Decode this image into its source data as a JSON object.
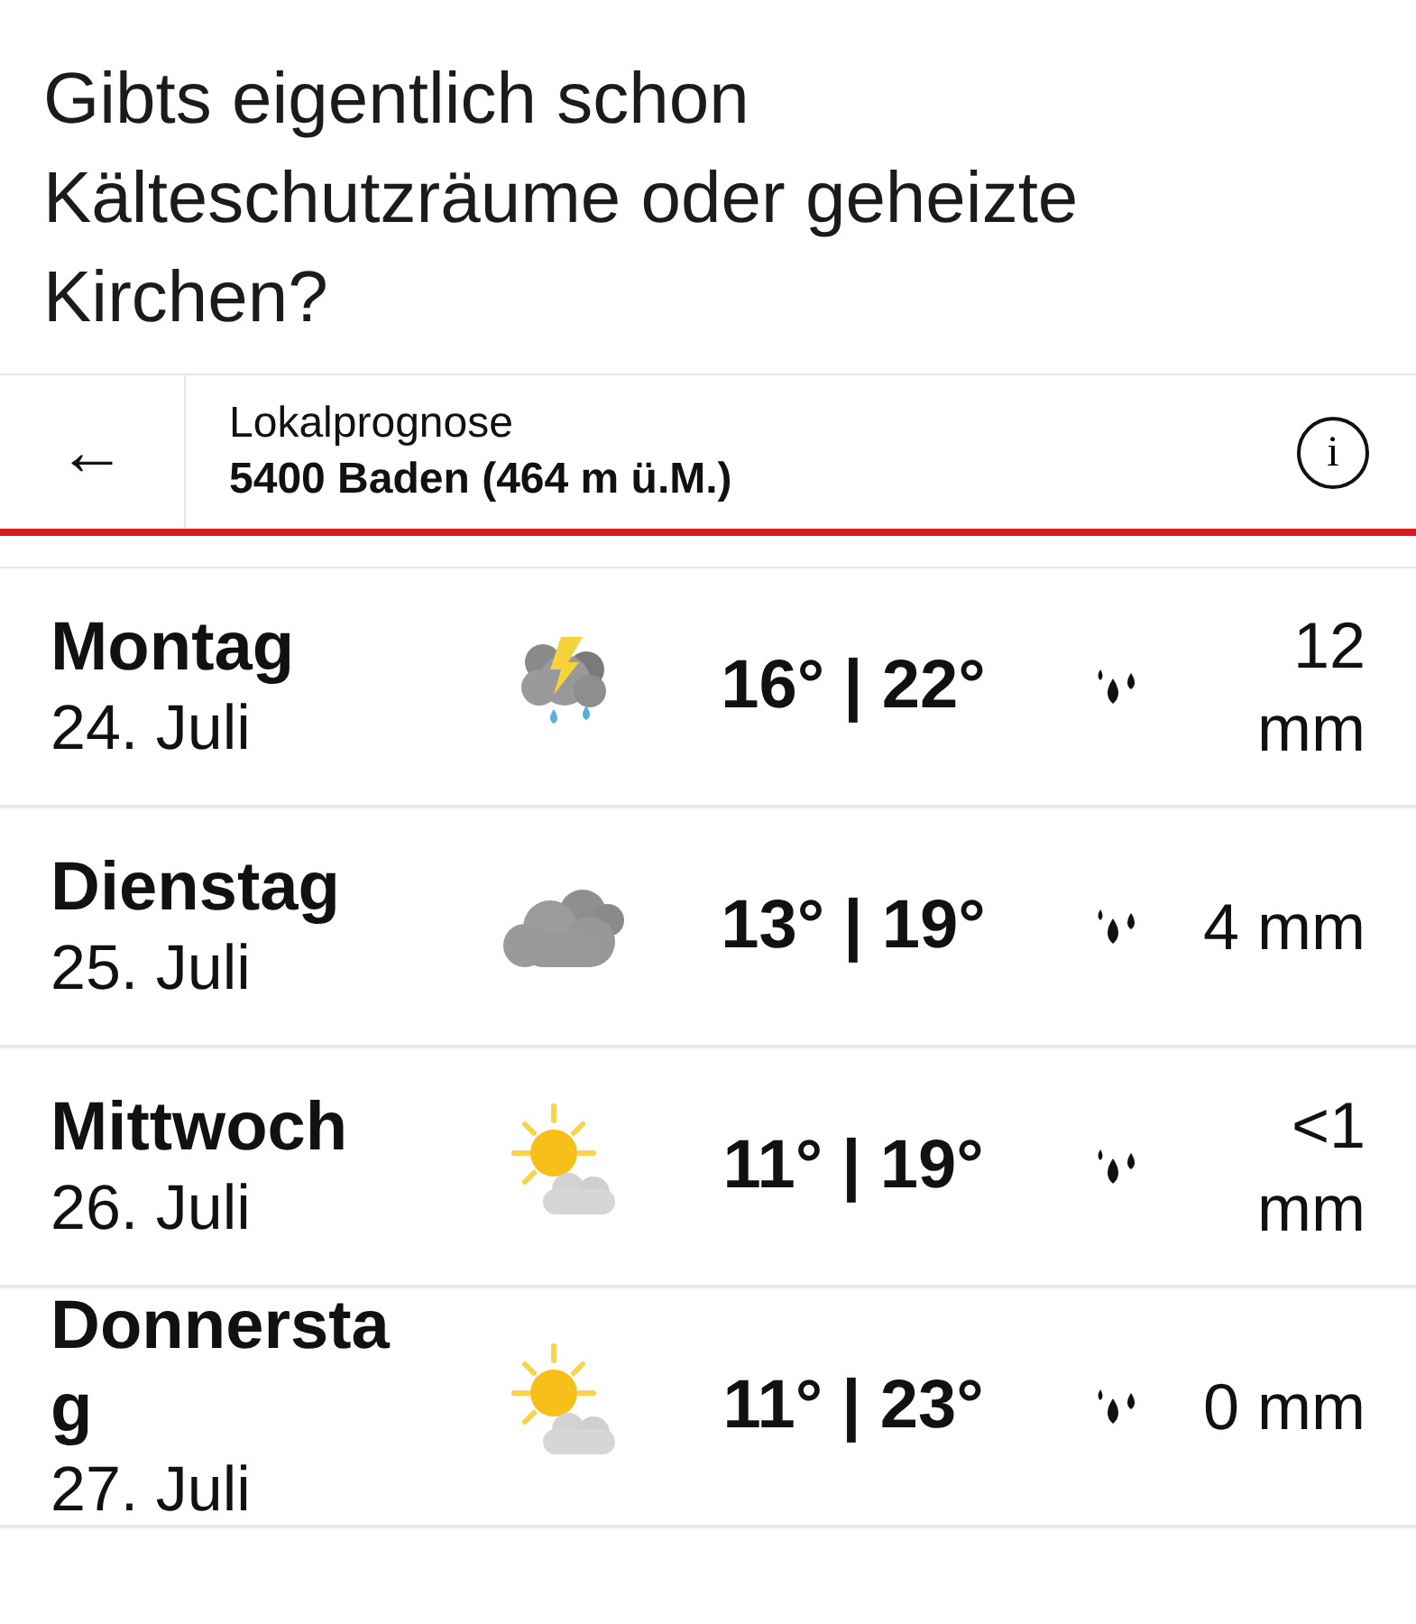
{
  "post_text": "Gibts eigentlich schon Kälteschutzräume oder geheizte Kirchen?",
  "header": {
    "back": "←",
    "title": "Lokalprognose",
    "location": "5400 Baden (464 m ü.M.)",
    "info": "i"
  },
  "days": [
    {
      "day": "Montag",
      "date": "24. Juli",
      "kind": "thunder_rain",
      "temps": "16° | 22°",
      "precip": "12 mm"
    },
    {
      "day": "Dienstag",
      "date": "25. Juli",
      "kind": "cloudy",
      "temps": "13° | 19°",
      "precip": "4 mm"
    },
    {
      "day": "Mittwoch",
      "date": "26. Juli",
      "kind": "sun_cloud",
      "temps": "11° | 19°",
      "precip": "<1 mm"
    },
    {
      "day": "Donnerstag",
      "date": "27. Juli",
      "kind": "sun_cloud",
      "temps": "11° | 23°",
      "precip": "0 mm"
    }
  ]
}
